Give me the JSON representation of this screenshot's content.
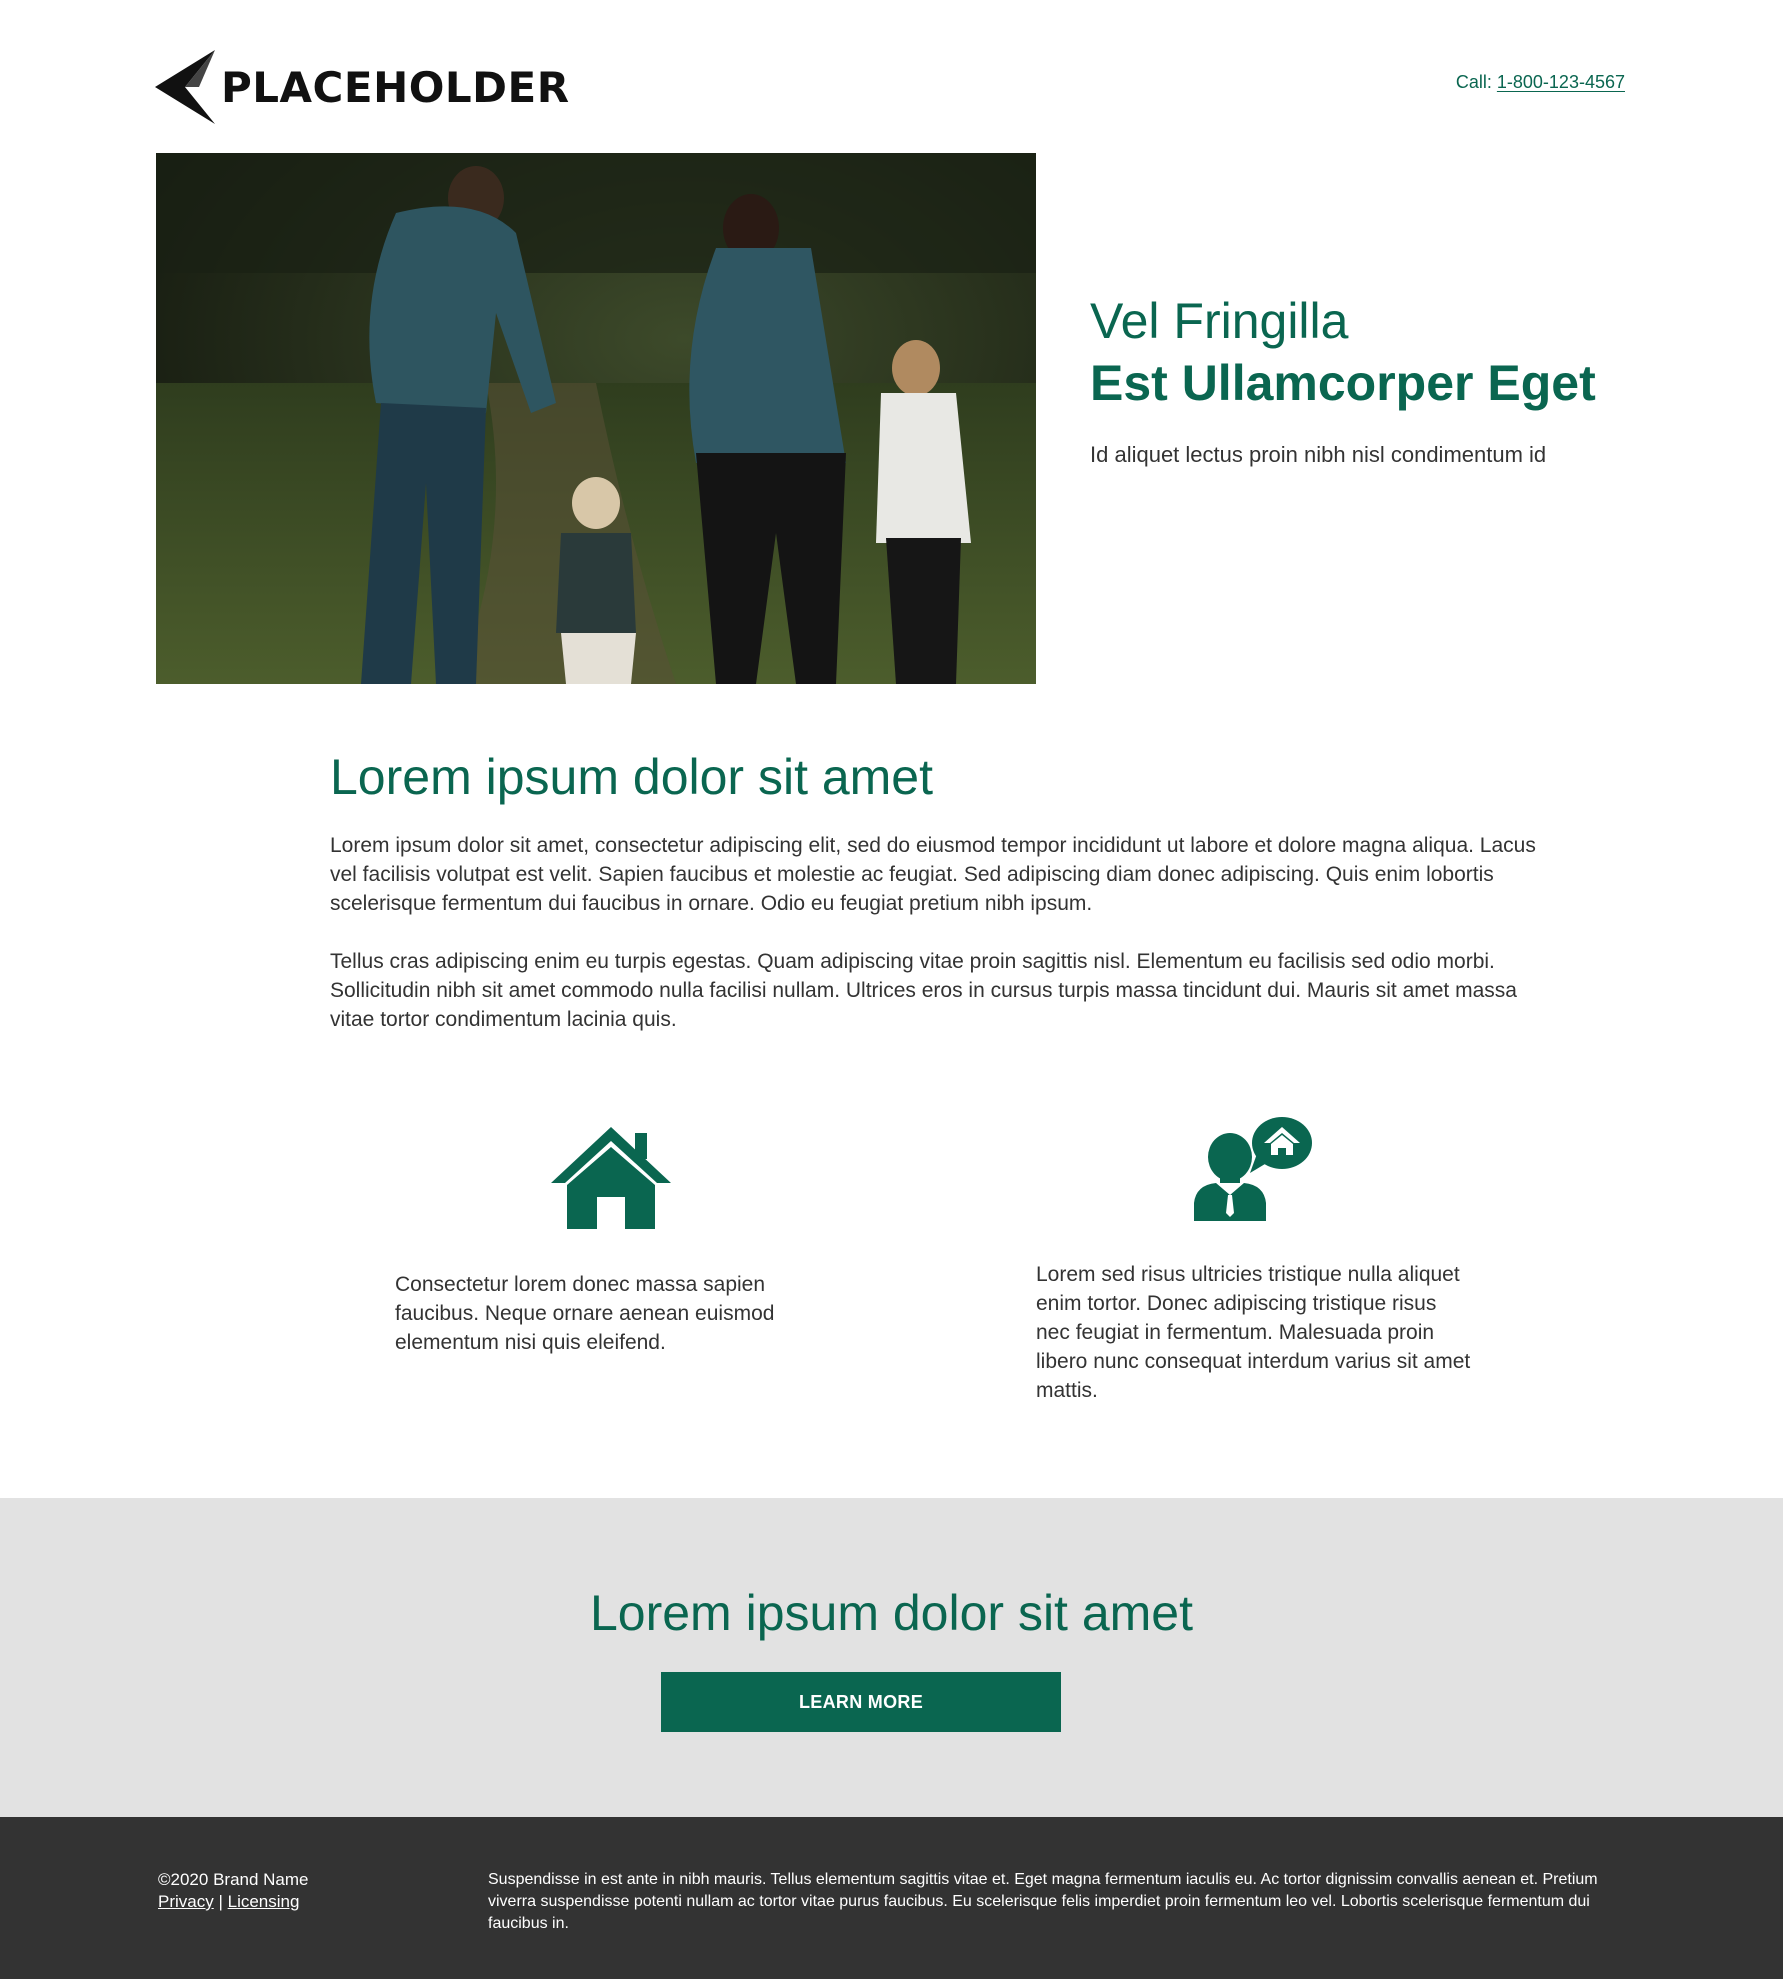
{
  "header": {
    "logo_text": "PLACEHOLDER",
    "call_label": "Call:",
    "phone": "1-800-123-4567"
  },
  "hero": {
    "title_line1": "Vel Fringilla",
    "title_line2": "Est Ullamcorper Eget",
    "subtitle": "Id aliquet lectus proin nibh nisl condimentum id"
  },
  "intro": {
    "heading": "Lorem ipsum dolor sit amet",
    "paragraph1": "Lorem ipsum dolor sit amet, consectetur adipiscing elit, sed do eiusmod tempor incididunt ut labore et dolore magna aliqua. Lacus vel facilisis volutpat est velit. Sapien faucibus et molestie ac feugiat. Sed adipiscing diam donec adipiscing. Quis enim lobortis scelerisque fermentum dui faucibus in ornare. Odio eu feugiat pretium nibh ipsum.",
    "paragraph2": "Tellus cras adipiscing enim eu turpis egestas. Quam adipiscing vitae proin sagittis nisl. Elementum eu facilisis sed odio morbi. Sollicitudin nibh sit amet commodo nulla facilisi nullam. Ultrices eros in cursus turpis massa tincidunt dui. Mauris sit amet massa vitae tortor condimentum lacinia quis."
  },
  "features": [
    {
      "icon": "house-icon",
      "text": "Consectetur lorem donec massa sapien faucibus. Neque ornare aenean euismod elementum nisi quis eleifend."
    },
    {
      "icon": "agent-house-speech-icon",
      "text": "Lorem sed risus ultricies tristique nulla aliquet enim tortor. Donec adipiscing tristique risus nec feugiat in fermentum. Malesuada proin libero nunc consequat interdum varius sit amet mattis."
    }
  ],
  "cta": {
    "heading": "Lorem ipsum dolor sit amet",
    "button_label": "LEARN MORE"
  },
  "footer": {
    "copyright": "©2020 Brand Name",
    "privacy": "Privacy",
    "separator": "|",
    "licensing": "Licensing",
    "disclaimer": "Suspendisse in est ante in nibh mauris. Tellus elementum sagittis vitae et. Eget magna fermentum iaculis eu. Ac tortor dignissim convallis aenean et. Pretium viverra suspendisse potenti nullam ac tortor vitae purus faucibus. Eu scelerisque felis imperdiet proin fermentum leo vel. Lobortis scelerisque fermentum dui faucibus in."
  },
  "colors": {
    "brand_green": "#0a6650",
    "cta_background": "#e2e2e2",
    "footer_background": "#333333"
  }
}
